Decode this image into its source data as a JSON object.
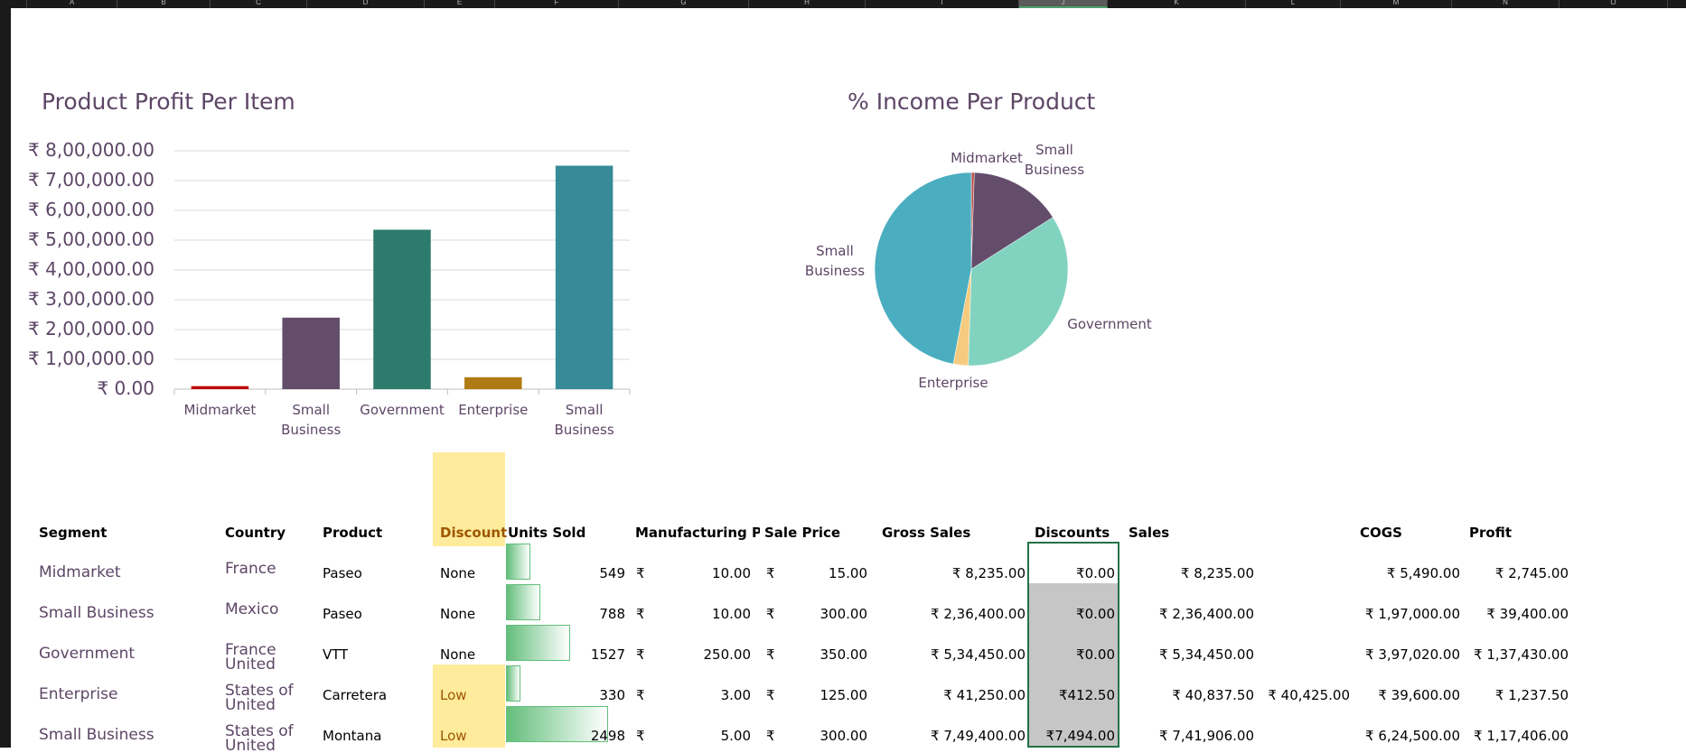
{
  "columns": [
    "A",
    "B",
    "C",
    "D",
    "E",
    "F",
    "G",
    "H",
    "I",
    "J",
    "K",
    "L",
    "M",
    "N",
    "O"
  ],
  "bar_chart_title": "Product Profit Per Item",
  "pie_chart_title": "% Income Per Product",
  "chart_data": [
    {
      "type": "bar",
      "title": "Product Profit Per Item",
      "categories": [
        "Midmarket",
        "Small Business",
        "Government",
        "Enterprise",
        "Small Business"
      ],
      "values": [
        10000,
        240000,
        535000,
        40000,
        750000
      ],
      "colors": [
        "#c00000",
        "#634d6b",
        "#2c7b6c",
        "#b07b14",
        "#378b99"
      ],
      "ylim": [
        0,
        800000
      ],
      "ytick_labels": [
        "₹ 8,00,000.00",
        "₹ 7,00,000.00",
        "₹ 6,00,000.00",
        "₹ 5,00,000.00",
        "₹ 4,00,000.00",
        "₹ 3,00,000.00",
        "₹ 2,00,000.00",
        "₹ 1,00,000.00",
        "₹ 0.00"
      ],
      "grid": true
    },
    {
      "type": "pie",
      "title": "% Income Per Product",
      "labels": [
        "Midmarket",
        "Small Business",
        "Government",
        "Enterprise",
        "Small Business"
      ],
      "values": [
        0.5,
        15.5,
        34.5,
        2.5,
        47
      ],
      "colors": [
        "#c0504d",
        "#634d6b",
        "#82d2c0",
        "#f5cc7f",
        "#4badc0"
      ]
    }
  ],
  "table": {
    "headers": {
      "segment": "Segment",
      "country": "Country",
      "product": "Product",
      "discount": "Discount",
      "units": "Units Sold",
      "mfg": "Manufacturing Pri",
      "sale": "Sale Price",
      "gross": "Gross Sales",
      "discounts": "Discounts",
      "sales": "Sales",
      "cogs": "COGS",
      "profit": "Profit"
    },
    "rows": [
      {
        "segment": "Midmarket",
        "country1": "France",
        "country2": "",
        "product": "Paseo",
        "discount": "None",
        "units": "549",
        "unit_frac": 0.24,
        "cur1": "₹",
        "mfg": "10.00",
        "cur2": "₹",
        "sale": "15.00",
        "gross": "₹ 8,235.00",
        "discounts": "₹0.00",
        "sales": "₹ 8,235.00",
        "extra": "",
        "cogs": "₹ 5,490.00",
        "profit": "₹ 2,745.00"
      },
      {
        "segment": "Small Business",
        "country1": "Mexico",
        "country2": "",
        "product": "Paseo",
        "discount": "None",
        "units": "788",
        "unit_frac": 0.34,
        "cur1": "₹",
        "mfg": "10.00",
        "cur2": "₹",
        "sale": "300.00",
        "gross": "₹ 2,36,400.00",
        "discounts": "₹0.00",
        "sales": "₹ 2,36,400.00",
        "extra": "",
        "cogs": "₹ 1,97,000.00",
        "profit": "₹ 39,400.00"
      },
      {
        "segment": "Government",
        "country1": "France",
        "country2": "United",
        "product": "VTT",
        "discount": "None",
        "units": "1527",
        "unit_frac": 0.63,
        "cur1": "₹",
        "mfg": "250.00",
        "cur2": "₹",
        "sale": "350.00",
        "gross": "₹ 5,34,450.00",
        "discounts": "₹0.00",
        "sales": "₹ 5,34,450.00",
        "extra": "",
        "cogs": "₹ 3,97,020.00",
        "profit": "₹ 1,37,430.00"
      },
      {
        "segment": "Enterprise",
        "country1": "States of",
        "country2": "United",
        "product": "Carretera",
        "discount": "Low",
        "units": "330",
        "unit_frac": 0.14,
        "cur1": "₹",
        "mfg": "3.00",
        "cur2": "₹",
        "sale": "125.00",
        "gross": "₹ 41,250.00",
        "discounts": "₹412.50",
        "sales": "₹ 40,837.50",
        "extra": "₹ 40,425.00",
        "cogs": "₹ 39,600.00",
        "profit": "₹ 1,237.50"
      },
      {
        "segment": "Small Business",
        "country1": "States of",
        "country2": "United",
        "product": "Montana",
        "discount": "Low",
        "units": "2498",
        "unit_frac": 1.0,
        "cur1": "₹",
        "mfg": "5.00",
        "cur2": "₹",
        "sale": "300.00",
        "gross": "₹ 7,49,400.00",
        "discounts": "₹7,494.00",
        "sales": "₹ 7,41,906.00",
        "extra": "",
        "cogs": "₹ 6,24,500.00",
        "profit": "₹ 1,17,406.00"
      }
    ]
  }
}
